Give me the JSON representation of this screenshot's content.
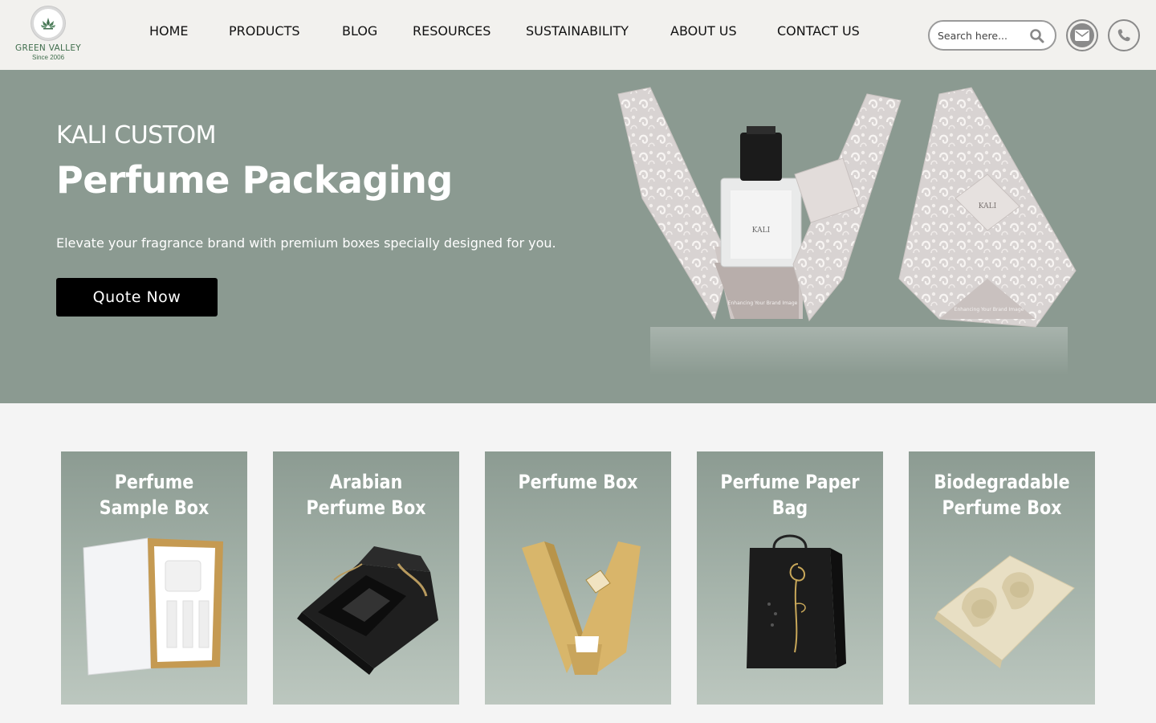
{
  "brand": {
    "name": "GREEN VALLEY",
    "since": "Since 2006"
  },
  "nav": {
    "items": [
      {
        "label": "HOME"
      },
      {
        "label": "PRODUCTS"
      },
      {
        "label": "BLOG"
      },
      {
        "label": "RESOURCES"
      },
      {
        "label": "SUSTAINABILITY"
      },
      {
        "label": "ABOUT US"
      },
      {
        "label": "CONTACT US"
      }
    ]
  },
  "search": {
    "placeholder": "Search here...",
    "value": ""
  },
  "header_actions": {
    "email_icon": "envelope-icon",
    "phone_icon": "phone-icon"
  },
  "hero": {
    "eyebrow": "KALI CUSTOM",
    "title": "Perfume Packaging",
    "subtitle": "Elevate your fragrance brand with premium boxes specially designed for you.",
    "cta_label": "Quote Now",
    "box_text": "Enhancing Your Brand Image",
    "box_logo": "KALI"
  },
  "products": [
    {
      "title": "Perfume Sample Box"
    },
    {
      "title": "Arabian Perfume Box"
    },
    {
      "title": "Perfume Box"
    },
    {
      "title": "Perfume Paper Bag"
    },
    {
      "title": "Biodegradable Perfume Box"
    }
  ],
  "colors": {
    "hero_bg": "#8b9a91",
    "header_bg": "#f2f1ee",
    "cta_bg": "#000000",
    "brand_green": "#3f6d4c"
  }
}
